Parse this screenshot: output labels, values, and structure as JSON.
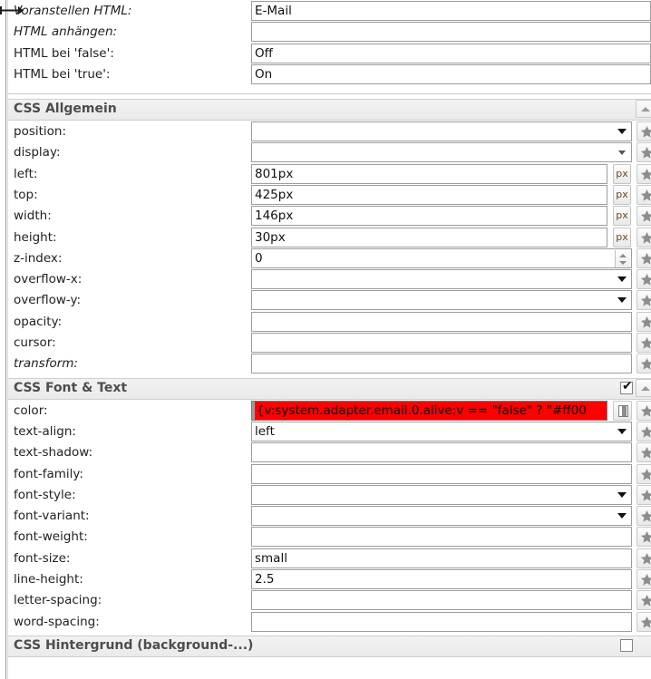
{
  "panel": {
    "splitter_icon": "horizontal-resize-handle-icon"
  },
  "top_rows": [
    {
      "label": "Voranstellen HTML:",
      "italic": true,
      "value": "E-Mail",
      "type": "text"
    },
    {
      "label": "HTML anhängen:",
      "italic": true,
      "value": "",
      "type": "text"
    },
    {
      "label": "HTML bei 'false':",
      "italic": false,
      "value": "Off",
      "type": "text"
    },
    {
      "label": "HTML bei 'true':",
      "italic": false,
      "value": "On",
      "type": "text"
    }
  ],
  "sections": [
    {
      "title": "CSS Allgemein",
      "checkbox": null,
      "collapse_icon": "collapse-up-icon",
      "rows": [
        {
          "label": "position:",
          "italic": false,
          "value": "",
          "type": "select",
          "unit": null,
          "star": true
        },
        {
          "label": "display:",
          "italic": false,
          "value": "",
          "type": "select-small",
          "unit": null,
          "star": true
        },
        {
          "label": "left:",
          "italic": false,
          "value": "801px",
          "type": "text",
          "unit": "px",
          "star": true
        },
        {
          "label": "top:",
          "italic": false,
          "value": "425px",
          "type": "text",
          "unit": "px",
          "star": true
        },
        {
          "label": "width:",
          "italic": false,
          "value": "146px",
          "type": "text",
          "unit": "px",
          "star": true
        },
        {
          "label": "height:",
          "italic": false,
          "value": "30px",
          "type": "text",
          "unit": "px",
          "star": true
        },
        {
          "label": "z-index:",
          "italic": false,
          "value": "0",
          "type": "number",
          "unit": null,
          "star": true
        },
        {
          "label": "overflow-x:",
          "italic": false,
          "value": "",
          "type": "select",
          "unit": null,
          "star": true
        },
        {
          "label": "overflow-y:",
          "italic": false,
          "value": "",
          "type": "select",
          "unit": null,
          "star": true
        },
        {
          "label": "opacity:",
          "italic": false,
          "value": "",
          "type": "text",
          "unit": null,
          "star": true
        },
        {
          "label": "cursor:",
          "italic": false,
          "value": "",
          "type": "text",
          "unit": null,
          "star": true
        },
        {
          "label": "transform:",
          "italic": true,
          "value": "",
          "type": "text",
          "unit": null,
          "star": true
        }
      ]
    },
    {
      "title": "CSS Font & Text",
      "checkbox": "checked",
      "collapse_icon": "collapse-up-icon",
      "rows": [
        {
          "label": "color:",
          "italic": false,
          "value": "{v:system.adapter.email.0.alive;v == \"false\" ? \"#ff00",
          "type": "color",
          "unit": null,
          "star": true,
          "selected": true
        },
        {
          "label": "text-align:",
          "italic": false,
          "value": "left",
          "type": "select",
          "unit": null,
          "star": true
        },
        {
          "label": "text-shadow:",
          "italic": false,
          "value": "",
          "type": "text",
          "unit": null,
          "star": true
        },
        {
          "label": "font-family:",
          "italic": false,
          "value": "",
          "type": "text",
          "unit": null,
          "star": true
        },
        {
          "label": "font-style:",
          "italic": false,
          "value": "",
          "type": "select",
          "unit": null,
          "star": true
        },
        {
          "label": "font-variant:",
          "italic": false,
          "value": "",
          "type": "select",
          "unit": null,
          "star": true
        },
        {
          "label": "font-weight:",
          "italic": false,
          "value": "",
          "type": "text",
          "unit": null,
          "star": true
        },
        {
          "label": "font-size:",
          "italic": false,
          "value": "small",
          "type": "text",
          "unit": null,
          "star": true
        },
        {
          "label": "line-height:",
          "italic": false,
          "value": "2.5",
          "type": "text",
          "unit": null,
          "star": true
        },
        {
          "label": "letter-spacing:",
          "italic": false,
          "value": "",
          "type": "text",
          "unit": null,
          "star": true
        },
        {
          "label": "word-spacing:",
          "italic": false,
          "value": "",
          "type": "text",
          "unit": null,
          "star": true
        }
      ]
    },
    {
      "title": "CSS Hintergrund (background-...)",
      "checkbox": "unchecked",
      "collapse_icon": null,
      "rows": []
    }
  ],
  "colors": {
    "selected_field_bg": "#ff0000",
    "header_bg": "#efefef",
    "header_text": "#4d4d4d",
    "field_border": "#9d9d9d"
  }
}
